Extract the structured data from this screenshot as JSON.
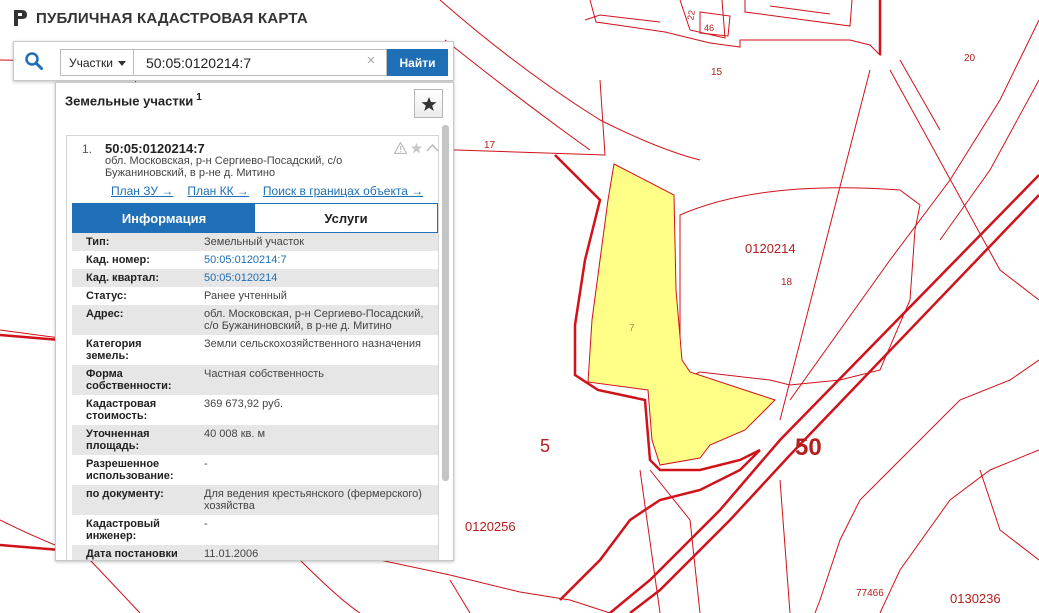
{
  "app": {
    "title": "ПУБЛИЧНАЯ КАДАСТРОВАЯ КАРТА"
  },
  "search": {
    "type_label": "Участки",
    "value": "50:05:0120214:7",
    "find_label": "Найти"
  },
  "results": {
    "header": "Земельные участки",
    "count": "1",
    "item": {
      "number": "1.",
      "cad_number": "50:05:0120214:7",
      "address": "обл. Московская, р-н Сергиево-Посадский, с/о Бужаниновский, в р-не д. Митино",
      "links": [
        "План ЗУ →",
        "План КК →",
        "Поиск в границах объекта →"
      ],
      "tabs": {
        "info": "Информация",
        "services": "Услуги"
      },
      "fields": [
        {
          "key": "Тип:",
          "value": "Земельный участок",
          "link": false
        },
        {
          "key": "Кад. номер:",
          "value": "50:05:0120214:7",
          "link": true
        },
        {
          "key": "Кад. квартал:",
          "value": "50:05:0120214",
          "link": true
        },
        {
          "key": "Статус:",
          "value": "Ранее учтенный",
          "link": false
        },
        {
          "key": "Адрес:",
          "value": "обл. Московская, р-н Сергиево-Посадский, с/о Бужаниновский, в р-не д. Митино",
          "link": false
        },
        {
          "key": "Категория земель:",
          "value": "Земли сельскохозяйственного назначения",
          "link": false
        },
        {
          "key": "Форма собственности:",
          "value": "Частная собственность",
          "link": false
        },
        {
          "key": "Кадастровая стоимость:",
          "value": "369 673,92 руб.",
          "link": false
        },
        {
          "key": "Уточненная площадь:",
          "value": "40 008 кв. м",
          "link": false
        },
        {
          "key": "Разрешенное использование:",
          "value": "-",
          "link": false
        },
        {
          "key": "по документу:",
          "value": "Для ведения крестьянского (фермерского) хозяйства",
          "link": false
        },
        {
          "key": "Кадастровый инженер:",
          "value": "-",
          "link": false
        },
        {
          "key": "Дата постановки на учет:",
          "value": "11.01.2006",
          "link": false
        }
      ]
    }
  },
  "map": {
    "labels": [
      "22",
      "46",
      "15",
      "20",
      "17",
      "0120214",
      "18",
      "7",
      "5",
      "50",
      "0120256",
      "77466",
      "0130236"
    ],
    "parcel_color": "#ffff88",
    "boundary_color": "#d0121b"
  },
  "colors": {
    "accent": "#1e6fb6"
  },
  "icons": {
    "search": "search-icon",
    "clear": "clear-icon",
    "star": "star-icon",
    "warning": "warning-icon",
    "collapse": "chevron-up-icon",
    "logo": "logo-icon"
  }
}
